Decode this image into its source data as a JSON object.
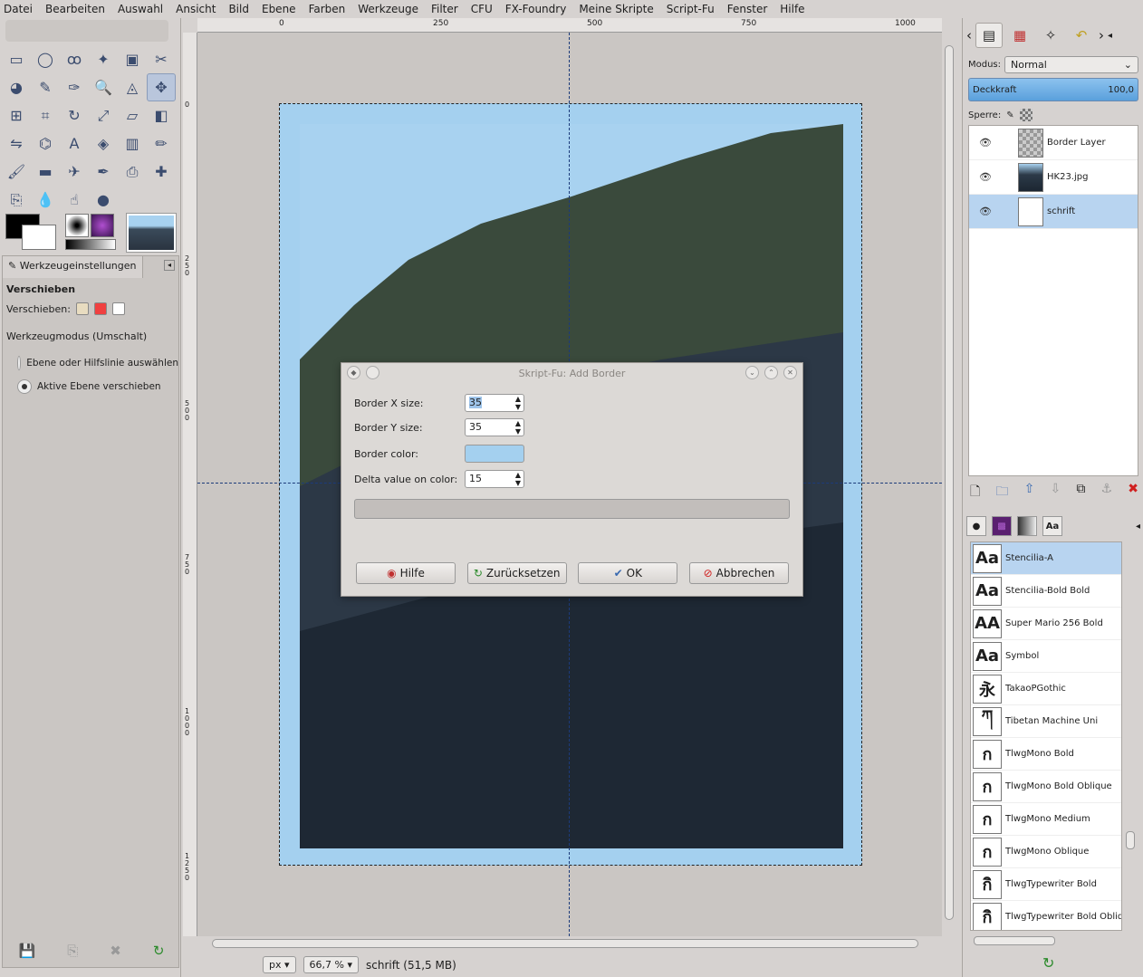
{
  "menu": [
    "Datei",
    "Bearbeiten",
    "Auswahl",
    "Ansicht",
    "Bild",
    "Ebene",
    "Farben",
    "Werkzeuge",
    "Filter",
    "CFU",
    "FX-Foundry",
    "Meine Skripte",
    "Script-Fu",
    "Fenster",
    "Hilfe"
  ],
  "tools": [
    "rect-select-icon",
    "ellipse-select-icon",
    "free-select-icon",
    "fuzzy-select-icon",
    "color-select-icon",
    "scissors-icon",
    "foreground-select-icon",
    "paths-icon",
    "color-picker-icon",
    "zoom-icon",
    "measure-icon",
    "move-icon",
    "align-icon",
    "crop-icon",
    "rotate-icon",
    "scale-icon",
    "shear-icon",
    "perspective-icon",
    "flip-icon",
    "cage-icon",
    "text-icon",
    "bucket-fill-icon",
    "blend-icon",
    "pencil-icon",
    "paintbrush-icon",
    "eraser-icon",
    "airbrush-icon",
    "ink-icon",
    "clone-icon",
    "heal-icon",
    "perspective-clone-icon",
    "blur-icon",
    "smudge-icon",
    "dodge-burn-icon"
  ],
  "tool_options": {
    "tab_label": "Werkzeugeinstellungen",
    "title": "Verschieben",
    "move_label": "Verschieben:",
    "mode_label": "Werkzeugmodus (Umschalt)",
    "radio1": "Ebene oder Hilfslinie auswählen",
    "radio2": "Aktive Ebene verschieben"
  },
  "ruler_h": [
    "0",
    "250",
    "500",
    "750",
    "1000"
  ],
  "ruler_v": [
    "0",
    "250",
    "500",
    "750",
    "1000",
    "1250"
  ],
  "dialog": {
    "title": "Skript-Fu: Add Border",
    "border_x_label": "Border X size:",
    "border_x_value": "35",
    "border_y_label": "Border Y size:",
    "border_y_value": "35",
    "border_color_label": "Border color:",
    "border_color": "#a4d0ef",
    "delta_label": "Delta value on color:",
    "delta_value": "15",
    "btn_help": "Hilfe",
    "btn_reset": "Zurücksetzen",
    "btn_ok": "OK",
    "btn_cancel": "Abbrechen"
  },
  "status": {
    "unit": "px",
    "zoom": "66,7 %",
    "info": "schrift (51,5 MB)"
  },
  "layers_panel": {
    "modus_label": "Modus:",
    "modus_value": "Normal",
    "opacity_label": "Deckkraft",
    "opacity_value": "100,0",
    "sperre_label": "Sperre:",
    "layers": [
      {
        "name": "Border Layer",
        "thumb": "checker"
      },
      {
        "name": "HK23.jpg",
        "thumb": "pic"
      },
      {
        "name": "schrift",
        "thumb": "white"
      }
    ]
  },
  "fonts": [
    {
      "name": "Stencilia-A",
      "glyph": "Aa"
    },
    {
      "name": "Stencilia-Bold Bold",
      "glyph": "Aa"
    },
    {
      "name": "Super Mario 256 Bold",
      "glyph": "AA"
    },
    {
      "name": "Symbol",
      "glyph": "Aa"
    },
    {
      "name": "TakaoPGothic",
      "glyph": "永"
    },
    {
      "name": "Tibetan Machine Uni",
      "glyph": "ཀ"
    },
    {
      "name": "TlwgMono Bold",
      "glyph": "ก"
    },
    {
      "name": "TlwgMono Bold Oblique",
      "glyph": "ก"
    },
    {
      "name": "TlwgMono Medium",
      "glyph": "ก"
    },
    {
      "name": "TlwgMono Oblique",
      "glyph": "ก"
    },
    {
      "name": "TlwgTypewriter Bold",
      "glyph": "กิ"
    },
    {
      "name": "TlwgTypewriter Bold Obliq",
      "glyph": "กิ"
    }
  ]
}
